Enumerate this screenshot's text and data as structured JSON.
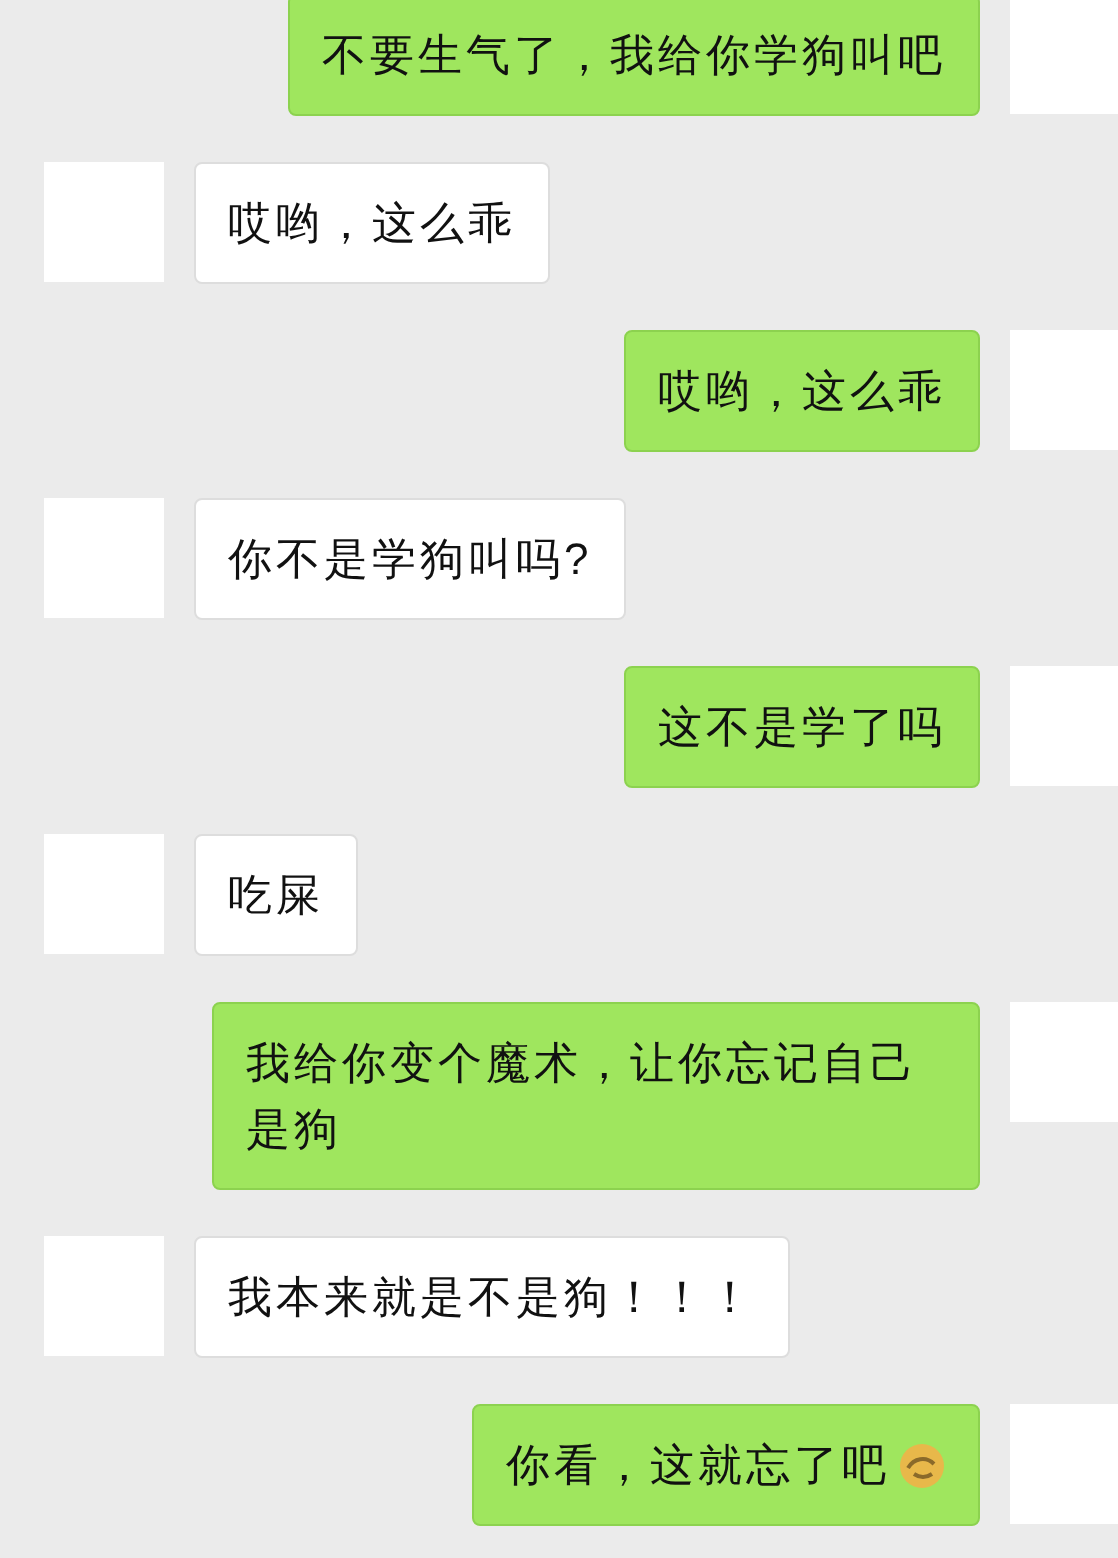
{
  "messages": [
    {
      "kind": "sent",
      "text": "不要生气了，我给你学狗叫吧"
    },
    {
      "kind": "received",
      "text": "哎哟，这么乖"
    },
    {
      "kind": "sent",
      "text": "哎哟，这么乖"
    },
    {
      "kind": "received",
      "text": "你不是学狗叫吗?"
    },
    {
      "kind": "sent",
      "text": "这不是学了吗"
    },
    {
      "kind": "received",
      "text": "吃屎"
    },
    {
      "kind": "sent",
      "text": "我给你变个魔术，让你忘记自己是狗"
    },
    {
      "kind": "received",
      "text": "我本来就是不是狗！！！"
    },
    {
      "kind": "sent",
      "text": "你看，这就忘了吧",
      "emoji": true
    }
  ]
}
